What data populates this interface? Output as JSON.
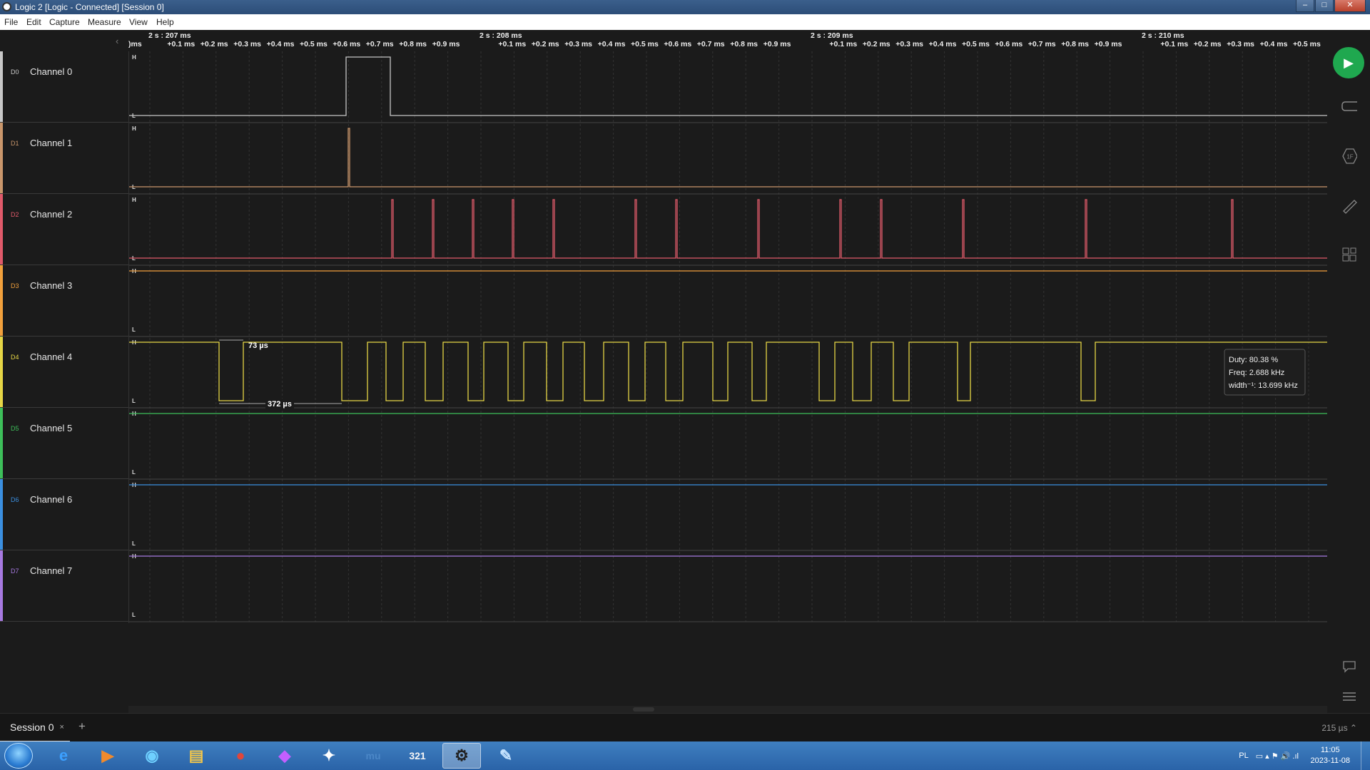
{
  "window": {
    "title": "Logic 2 [Logic - Connected] [Session 0]",
    "min": "–",
    "max": "□",
    "close": "✕"
  },
  "menu": [
    "File",
    "Edit",
    "Capture",
    "Measure",
    "View",
    "Help"
  ],
  "ruler": {
    "major": [
      "2 s : 207 ms",
      "2 s : 208 ms",
      "2 s : 209 ms",
      "2 s : 210 ms"
    ],
    "minor": [
      "+0.1 ms",
      "+0.2 ms",
      "+0.3 ms",
      "+0.4 ms",
      "+0.5 ms",
      "+0.6 ms",
      "+0.7 ms",
      "+0.8 ms",
      "+0.9 ms"
    ],
    "edge_label": ")ms"
  },
  "channels": [
    {
      "id": "D0",
      "name": "Channel 0",
      "color": "#c7c7c7"
    },
    {
      "id": "D1",
      "name": "Channel 1",
      "color": "#c9966b"
    },
    {
      "id": "D2",
      "name": "Channel 2",
      "color": "#e05a6a"
    },
    {
      "id": "D3",
      "name": "Channel 3",
      "color": "#f2a03c"
    },
    {
      "id": "D4",
      "name": "Channel 4",
      "color": "#e6d646"
    },
    {
      "id": "D5",
      "name": "Channel 5",
      "color": "#3dbf5a"
    },
    {
      "id": "D6",
      "name": "Channel 6",
      "color": "#3b8fe0"
    },
    {
      "id": "D7",
      "name": "Channel 7",
      "color": "#a779e0"
    }
  ],
  "level_high": "H",
  "level_low": "L",
  "measurements": {
    "pulse_width": "73 µs",
    "period": "372 µs"
  },
  "tooltip": {
    "duty": "Duty: 80.38 %",
    "freq": "Freq: 2.688 kHz",
    "width_inv": "width⁻¹: 13.699 kHz"
  },
  "rail": {
    "play": "▶",
    "trigger_badge": "1F"
  },
  "tabs": {
    "session": "Session 0",
    "close": "×",
    "add": "+"
  },
  "sample_rate": "215 µs ⌃",
  "taskbar": {
    "apps": [
      "e",
      "▶",
      "◉",
      "▤",
      "●",
      "◆",
      "✦",
      "mu",
      "321",
      "⚙",
      "✎"
    ],
    "tray_lang": "PL",
    "tray_icons": "▭  ▴  ⚑  🔊  .ıl",
    "time": "11:05",
    "date": "2023-11-08"
  }
}
